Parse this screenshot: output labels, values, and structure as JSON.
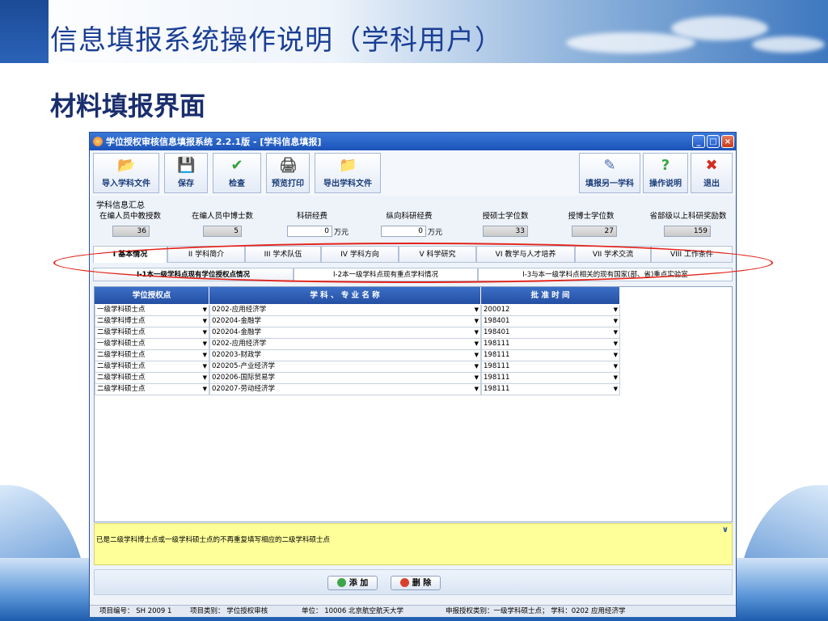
{
  "slide": {
    "title": "信息填报系统操作说明（学科用户）",
    "subtitle": "材料填报界面"
  },
  "window": {
    "title": "学位授权审核信息填报系统 2.2.1版  - [学科信息填报]",
    "controls": [
      "_",
      "□",
      "×"
    ]
  },
  "toolbar": {
    "import": "导入学科文件",
    "save": "保存",
    "check": "检查",
    "preview_print": "预览打印",
    "export": "导出学科文件",
    "fill_other": "填报另一学科",
    "help": "操作说明",
    "exit": "退出"
  },
  "summary": {
    "label": "学科信息汇总",
    "items": [
      {
        "label": "在编人员中教授数",
        "value": "36"
      },
      {
        "label": "在编人员中博士数",
        "value": "5"
      },
      {
        "label": "科研经费",
        "value": "0",
        "unit": "万元"
      },
      {
        "label": "纵向科研经费",
        "value": "0",
        "unit": "万元"
      },
      {
        "label": "授硕士学位数",
        "value": "33"
      },
      {
        "label": "授博士学位数",
        "value": "27"
      },
      {
        "label": "省部级以上科研奖励数",
        "value": "159"
      }
    ]
  },
  "tabs": [
    {
      "label": "I 基本情况",
      "active": true
    },
    {
      "label": "II 学科简介"
    },
    {
      "label": "III 学术队伍"
    },
    {
      "label": "IV 学科方向"
    },
    {
      "label": "V 科学研究"
    },
    {
      "label": "VI 教学与人才培养"
    },
    {
      "label": "VII 学术交流"
    },
    {
      "label": "VIII 工作条件"
    }
  ],
  "subtabs": [
    {
      "label": "I-1本一级学科点现有学位授权点情况",
      "active": true
    },
    {
      "label": "I-2本一级学科点现有重点学科情况"
    },
    {
      "label": "I-3与本一级学科点相关的现有国家(部、省)重点实验室"
    }
  ],
  "grid": {
    "columns": [
      "学位授权点",
      "学 科 、 专 业 名 称",
      "批 准 时 间"
    ],
    "rows": [
      [
        "一级学科硕士点",
        "0202-应用经济学",
        "200012"
      ],
      [
        "二级学科博士点",
        "020204-金融学",
        "198401"
      ],
      [
        "二级学科硕士点",
        "020204-金融学",
        "198401"
      ],
      [
        "一级学科硕士点",
        "0202-应用经济学",
        "198111"
      ],
      [
        "二级学科硕士点",
        "020203-财政学",
        "198111"
      ],
      [
        "二级学科硕士点",
        "020205-产业经济学",
        "198111"
      ],
      [
        "二级学科硕士点",
        "020206-国际贸易学",
        "198111"
      ],
      [
        "二级学科硕士点",
        "020207-劳动经济学",
        "198111"
      ]
    ]
  },
  "note": "已是二级学科博士点或一级学科硕士点的不再重复填写相应的二级学科硕士点",
  "actions": {
    "add": "添 加",
    "delete": "删 除"
  },
  "status": {
    "project_no": "项目编号： SH 2009 1",
    "project_type": "项目类别： 学位授权审核",
    "unit": "单位： 10006 北京航空航天大学",
    "apply_type": "申报授权类别：一级学科硕士点；  学科：0202 应用经济学"
  },
  "colors": {
    "accent": "#1c52b8",
    "highlight": "#e2231a",
    "note_bg": "#ffff9a"
  }
}
